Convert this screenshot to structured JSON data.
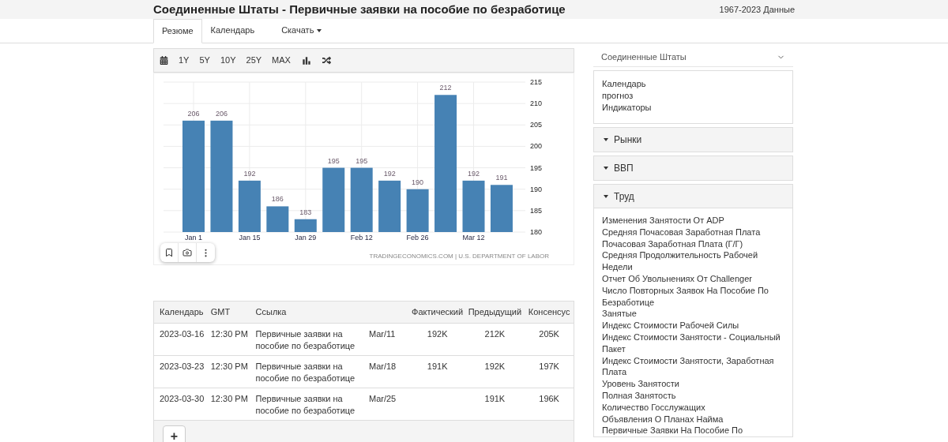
{
  "header": {
    "title": "Соединенные Штаты - Первичные заявки на пособие по безработице",
    "range": "1967-2023 Данные"
  },
  "tabs": [
    {
      "label": "Резюме",
      "selected": true,
      "kind": "tab"
    },
    {
      "label": "Календарь",
      "selected": false,
      "kind": "tab"
    },
    {
      "label": "Скачать",
      "selected": false,
      "kind": "dropdown"
    }
  ],
  "chart_toolbar": {
    "ranges": [
      "1Y",
      "5Y",
      "10Y",
      "25Y",
      "MAX"
    ]
  },
  "chart": {
    "chart_data": {
      "type": "bar",
      "values": [
        206,
        206,
        192,
        186,
        183,
        195,
        195,
        192,
        190,
        212,
        192,
        191
      ],
      "ylim": [
        180,
        215
      ],
      "yticks": [
        180,
        185,
        190,
        195,
        200,
        205,
        210,
        215
      ],
      "categories": [
        "Jan 1",
        null,
        "Jan 15",
        null,
        "Jan 29",
        null,
        "Feb 12",
        null,
        "Feb 26",
        null,
        "Mar 12",
        null
      ],
      "grid": true,
      "data_labels": true,
      "annotations": [
        "TRADINGECONOMICS.COM | U.S. DEPARTMENT OF LABOR"
      ]
    }
  },
  "table": {
    "columns": [
      "Календарь",
      "GMT",
      "Ссылка",
      "",
      "Фактический",
      "Предыдущий",
      "Консенсус"
    ],
    "rows": [
      {
        "date": "2023-03-16",
        "time": "12:30 PM",
        "event": "Первичные заявки на пособие по безработице",
        "reference": "Mar/11",
        "actual": "192K",
        "previous": "212K",
        "consensus": "205K"
      },
      {
        "date": "2023-03-23",
        "time": "12:30 PM",
        "event": "Первичные заявки на пособие по безработице",
        "reference": "Mar/18",
        "actual": "191K",
        "previous": "192K",
        "consensus": "197K"
      },
      {
        "date": "2023-03-30",
        "time": "12:30 PM",
        "event": "Первичные заявки на пособие по безработице",
        "reference": "Mar/25",
        "previous": "191K",
        "consensus": "196K"
      }
    ],
    "add_button": "+"
  },
  "sidebar": {
    "country_select": "Соединенные Штаты",
    "links": [
      "Календарь",
      "прогноз",
      "Индикаторы"
    ],
    "sections": [
      {
        "title": "Рынки",
        "expanded": false
      },
      {
        "title": "ВВП",
        "expanded": false
      },
      {
        "title": "Труд",
        "expanded": true,
        "items": [
          "Изменения Занятости От ADP",
          "Средняя Почасовая Заработная Плата",
          "Почасовая Заработная Плата (Г/Г)",
          "Средняя Продолжительность Рабочей Недели",
          "Отчет Об Увольнениях От Challenger",
          "Число Повторных Заявок На Пособие По Безработице",
          "Занятые",
          "Индекс Стоимости Рабочей Силы",
          "Индекс Стоимости Занятости - Социальный Пакет",
          "Индекс Стоимости Занятости, Заработная Плата",
          "Уровень Занятости",
          "Полная Занятость",
          "Количество Госслужащих",
          "Объявления О Планах Найма",
          "Первичные Заявки На Пособие По"
        ]
      }
    ]
  }
}
